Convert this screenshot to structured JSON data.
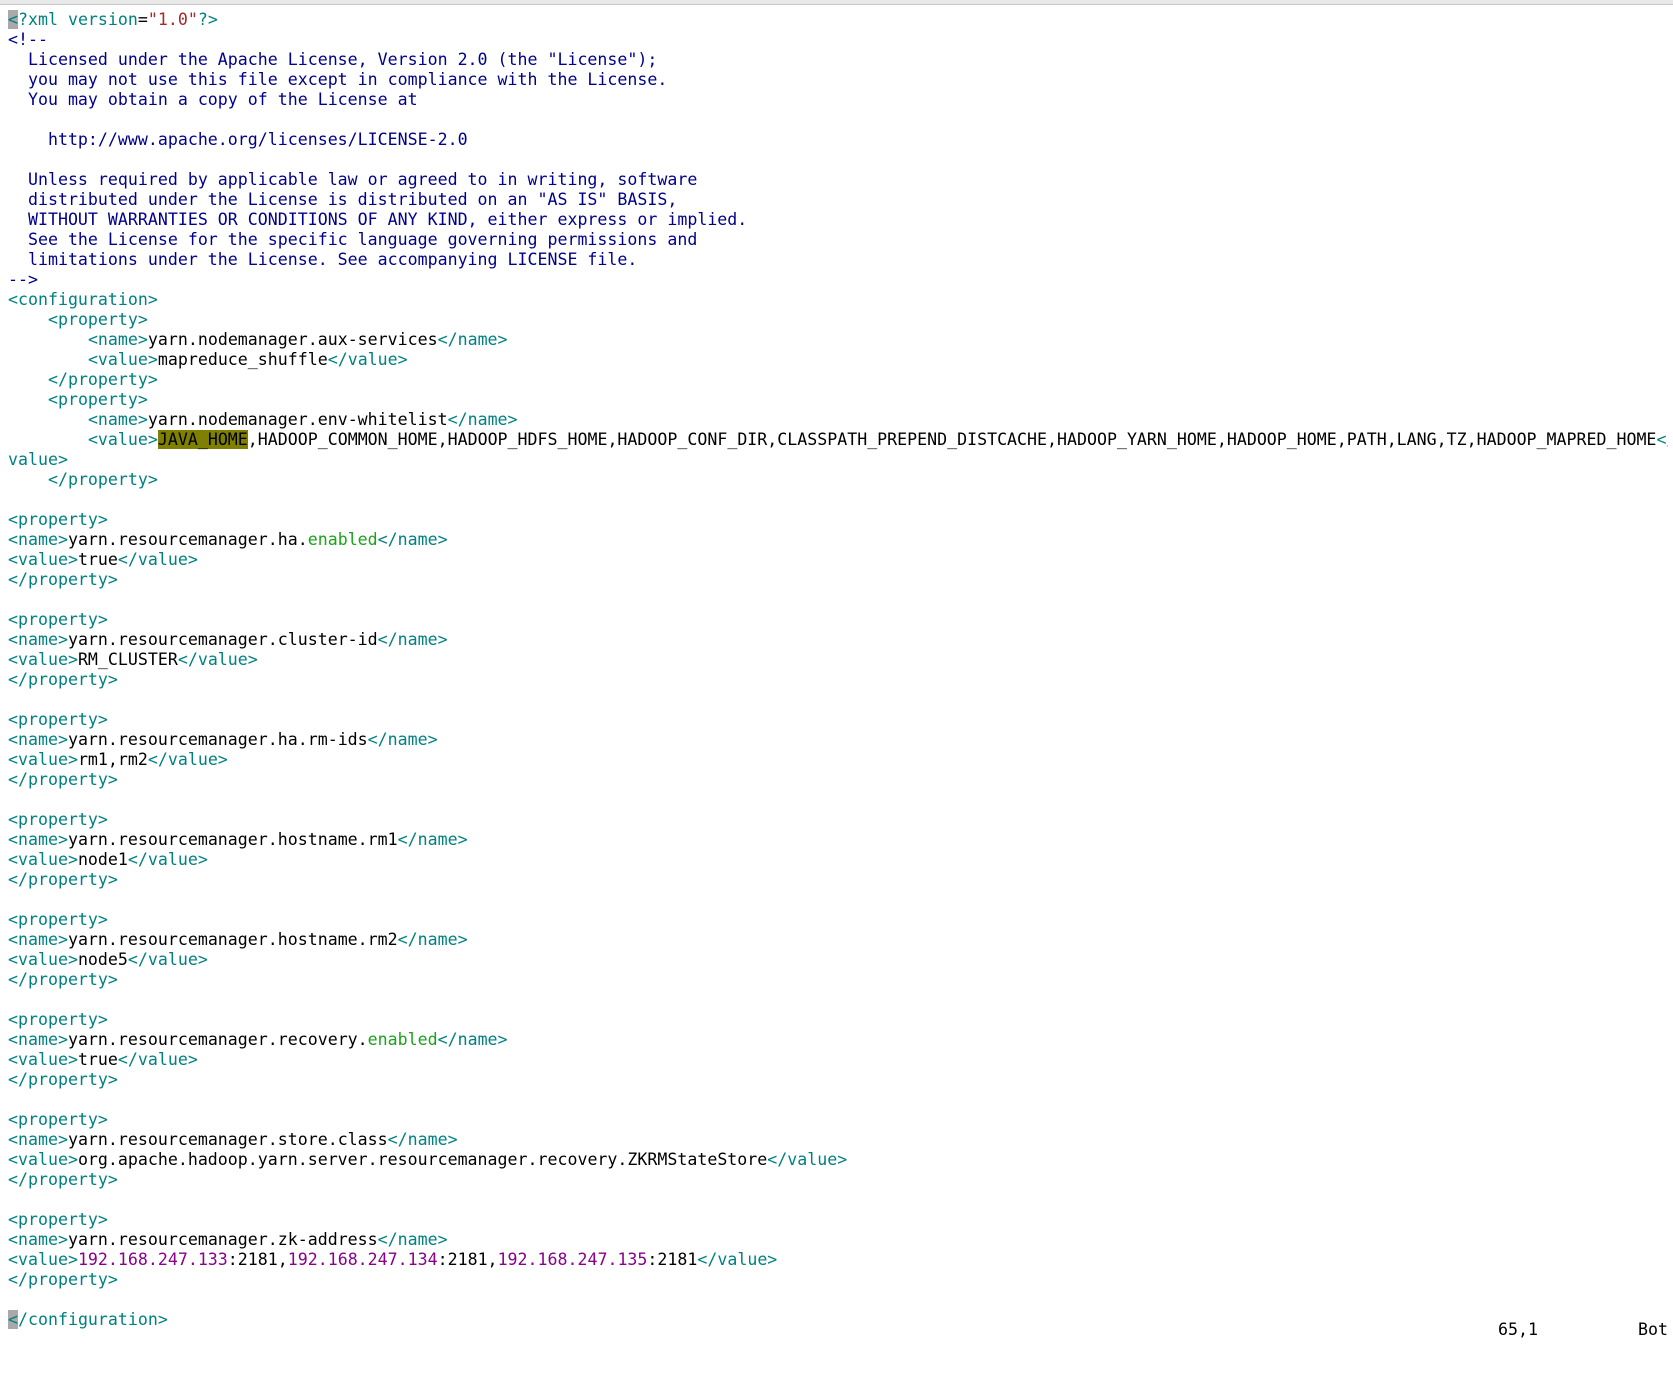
{
  "colors": {
    "background": "#ffffff",
    "text": "#000000",
    "tag": "#008080",
    "comment": "#00008b",
    "attr_value": "#a52a2a",
    "keyword": "#1aa31a",
    "number": "#8b008b",
    "cursor_bg": "#a9a9a9",
    "search_bg": "#808000"
  },
  "editor": {
    "lines": [
      [
        {
          "t": "<",
          "c": "cursor"
        },
        {
          "t": "?xml ",
          "c": "tag"
        },
        {
          "t": "version",
          "c": "tag"
        },
        {
          "t": "=",
          "c": "text"
        },
        {
          "t": "\"1.0\"",
          "c": "attr_value"
        },
        {
          "t": "?>",
          "c": "tag"
        }
      ],
      [
        {
          "t": "<!--",
          "c": "comment"
        }
      ],
      [
        {
          "t": "  Licensed under the Apache License, Version 2.0 (the \"License\");",
          "c": "comment"
        }
      ],
      [
        {
          "t": "  you may not use this file except in compliance with the License.",
          "c": "comment"
        }
      ],
      [
        {
          "t": "  You may obtain a copy of the License at",
          "c": "comment"
        }
      ],
      [],
      [
        {
          "t": "    http://www.apache.org/licenses/LICENSE-2.0",
          "c": "comment"
        }
      ],
      [],
      [
        {
          "t": "  Unless required by applicable law or agreed to in writing, software",
          "c": "comment"
        }
      ],
      [
        {
          "t": "  distributed under the License is distributed on an \"AS IS\" BASIS,",
          "c": "comment"
        }
      ],
      [
        {
          "t": "  WITHOUT WARRANTIES OR CONDITIONS OF ANY KIND, either express or implied.",
          "c": "comment"
        }
      ],
      [
        {
          "t": "  See the License for the specific language governing permissions and",
          "c": "comment"
        }
      ],
      [
        {
          "t": "  limitations under the License. See accompanying LICENSE file.",
          "c": "comment"
        }
      ],
      [
        {
          "t": "-->",
          "c": "comment"
        }
      ],
      [
        {
          "t": "<configuration>",
          "c": "tag"
        }
      ],
      [
        {
          "t": "    ",
          "c": "text"
        },
        {
          "t": "<property>",
          "c": "tag"
        }
      ],
      [
        {
          "t": "        ",
          "c": "text"
        },
        {
          "t": "<name>",
          "c": "tag"
        },
        {
          "t": "yarn.nodemanager.aux-services",
          "c": "text"
        },
        {
          "t": "</name>",
          "c": "tag"
        }
      ],
      [
        {
          "t": "        ",
          "c": "text"
        },
        {
          "t": "<value>",
          "c": "tag"
        },
        {
          "t": "mapreduce_shuffle",
          "c": "text"
        },
        {
          "t": "</value>",
          "c": "tag"
        }
      ],
      [
        {
          "t": "    ",
          "c": "text"
        },
        {
          "t": "</property>",
          "c": "tag"
        }
      ],
      [
        {
          "t": "    ",
          "c": "text"
        },
        {
          "t": "<property>",
          "c": "tag"
        }
      ],
      [
        {
          "t": "        ",
          "c": "text"
        },
        {
          "t": "<name>",
          "c": "tag"
        },
        {
          "t": "yarn.nodemanager.env-whitelist",
          "c": "text"
        },
        {
          "t": "</name>",
          "c": "tag"
        }
      ],
      [
        {
          "t": "        ",
          "c": "text"
        },
        {
          "t": "<value>",
          "c": "tag"
        },
        {
          "t": "JAVA_HOME",
          "c": "search"
        },
        {
          "t": ",HADOOP_COMMON_HOME,HADOOP_HDFS_HOME,HADOOP_CONF_DIR,CLASSPATH_PREPEND_DISTCACHE,HADOOP_YARN_HOME,HADOOP_HOME,PATH,LANG,TZ,HADOOP_MAPRED_HOME",
          "c": "text"
        },
        {
          "t": "</",
          "c": "tag"
        }
      ],
      [
        {
          "t": "value>",
          "c": "tag"
        }
      ],
      [
        {
          "t": "    ",
          "c": "text"
        },
        {
          "t": "</property>",
          "c": "tag"
        }
      ],
      [],
      [
        {
          "t": "<property>",
          "c": "tag"
        }
      ],
      [
        {
          "t": "<name>",
          "c": "tag"
        },
        {
          "t": "yarn.resourcemanager.ha.",
          "c": "text"
        },
        {
          "t": "enabled",
          "c": "keyword"
        },
        {
          "t": "</name>",
          "c": "tag"
        }
      ],
      [
        {
          "t": "<value>",
          "c": "tag"
        },
        {
          "t": "true",
          "c": "text"
        },
        {
          "t": "</value>",
          "c": "tag"
        }
      ],
      [
        {
          "t": "</property>",
          "c": "tag"
        }
      ],
      [],
      [
        {
          "t": "<property>",
          "c": "tag"
        }
      ],
      [
        {
          "t": "<name>",
          "c": "tag"
        },
        {
          "t": "yarn.resourcemanager.cluster-id",
          "c": "text"
        },
        {
          "t": "</name>",
          "c": "tag"
        }
      ],
      [
        {
          "t": "<value>",
          "c": "tag"
        },
        {
          "t": "RM_CLUSTER",
          "c": "text"
        },
        {
          "t": "</value>",
          "c": "tag"
        }
      ],
      [
        {
          "t": "</property>",
          "c": "tag"
        }
      ],
      [],
      [
        {
          "t": "<property>",
          "c": "tag"
        }
      ],
      [
        {
          "t": "<name>",
          "c": "tag"
        },
        {
          "t": "yarn.resourcemanager.ha.rm-ids",
          "c": "text"
        },
        {
          "t": "</name>",
          "c": "tag"
        }
      ],
      [
        {
          "t": "<value>",
          "c": "tag"
        },
        {
          "t": "rm1,rm2",
          "c": "text"
        },
        {
          "t": "</value>",
          "c": "tag"
        }
      ],
      [
        {
          "t": "</property>",
          "c": "tag"
        }
      ],
      [],
      [
        {
          "t": "<property>",
          "c": "tag"
        }
      ],
      [
        {
          "t": "<name>",
          "c": "tag"
        },
        {
          "t": "yarn.resourcemanager.hostname.rm1",
          "c": "text"
        },
        {
          "t": "</name>",
          "c": "tag"
        }
      ],
      [
        {
          "t": "<value>",
          "c": "tag"
        },
        {
          "t": "node1",
          "c": "text"
        },
        {
          "t": "</value>",
          "c": "tag"
        }
      ],
      [
        {
          "t": "</property>",
          "c": "tag"
        }
      ],
      [],
      [
        {
          "t": "<property>",
          "c": "tag"
        }
      ],
      [
        {
          "t": "<name>",
          "c": "tag"
        },
        {
          "t": "yarn.resourcemanager.hostname.rm2",
          "c": "text"
        },
        {
          "t": "</name>",
          "c": "tag"
        }
      ],
      [
        {
          "t": "<value>",
          "c": "tag"
        },
        {
          "t": "node5",
          "c": "text"
        },
        {
          "t": "</value>",
          "c": "tag"
        }
      ],
      [
        {
          "t": "</property>",
          "c": "tag"
        }
      ],
      [],
      [
        {
          "t": "<property>",
          "c": "tag"
        }
      ],
      [
        {
          "t": "<name>",
          "c": "tag"
        },
        {
          "t": "yarn.resourcemanager.recovery.",
          "c": "text"
        },
        {
          "t": "enabled",
          "c": "keyword"
        },
        {
          "t": "</name>",
          "c": "tag"
        }
      ],
      [
        {
          "t": "<value>",
          "c": "tag"
        },
        {
          "t": "true",
          "c": "text"
        },
        {
          "t": "</value>",
          "c": "tag"
        }
      ],
      [
        {
          "t": "</property>",
          "c": "tag"
        }
      ],
      [],
      [
        {
          "t": "<property>",
          "c": "tag"
        }
      ],
      [
        {
          "t": "<name>",
          "c": "tag"
        },
        {
          "t": "yarn.resourcemanager.store.class",
          "c": "text"
        },
        {
          "t": "</name>",
          "c": "tag"
        }
      ],
      [
        {
          "t": "<value>",
          "c": "tag"
        },
        {
          "t": "org.apache.hadoop.yarn.server.resourcemanager.recovery.ZKRMStateStore",
          "c": "text"
        },
        {
          "t": "</value>",
          "c": "tag"
        }
      ],
      [
        {
          "t": "</property>",
          "c": "tag"
        }
      ],
      [],
      [
        {
          "t": "<property>",
          "c": "tag"
        }
      ],
      [
        {
          "t": "<name>",
          "c": "tag"
        },
        {
          "t": "yarn.resourcemanager.zk-address",
          "c": "text"
        },
        {
          "t": "</name>",
          "c": "tag"
        }
      ],
      [
        {
          "t": "<value>",
          "c": "tag"
        },
        {
          "t": "192.168.247.133",
          "c": "number"
        },
        {
          "t": ":2181,",
          "c": "text"
        },
        {
          "t": "192.168.247.134",
          "c": "number"
        },
        {
          "t": ":2181,",
          "c": "text"
        },
        {
          "t": "192.168.247.135",
          "c": "number"
        },
        {
          "t": ":2181",
          "c": "text"
        },
        {
          "t": "</value>",
          "c": "tag"
        }
      ],
      [
        {
          "t": "</property>",
          "c": "tag"
        }
      ],
      [],
      [
        {
          "t": "<",
          "c": "cursor"
        },
        {
          "t": "/configuration>",
          "c": "tag"
        }
      ]
    ]
  },
  "status": {
    "position": "65,1",
    "scroll": "Bot"
  }
}
